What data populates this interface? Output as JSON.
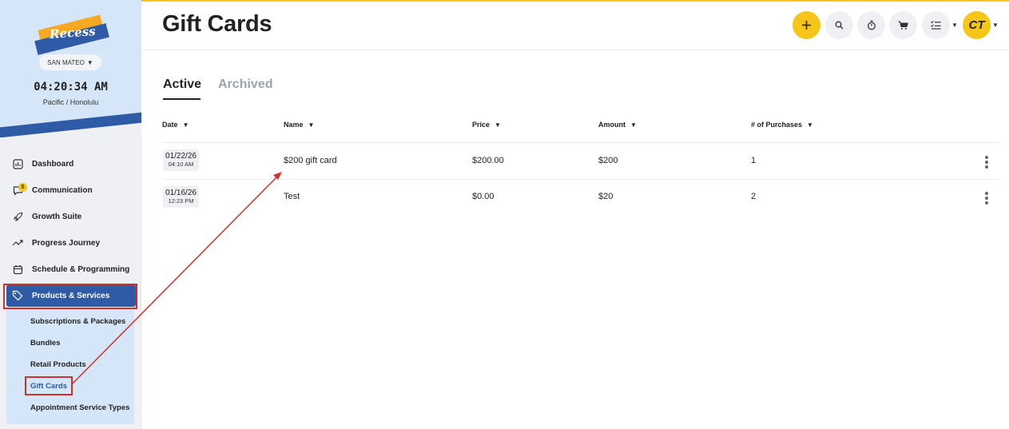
{
  "brand": {
    "logo_text": "Recess",
    "accent": "#f5c518",
    "primary": "#2f5aa6"
  },
  "location": {
    "name": "SAN MATEO"
  },
  "clock": {
    "time": "04:20:34 AM",
    "timezone": "Pacific / Honolulu"
  },
  "sidebar": {
    "items": [
      {
        "label": "Dashboard",
        "icon": "chart-icon"
      },
      {
        "label": "Communication",
        "icon": "chat-icon",
        "badge": "5"
      },
      {
        "label": "Growth Suite",
        "icon": "rocket-icon"
      },
      {
        "label": "Progress Journey",
        "icon": "trend-icon"
      },
      {
        "label": "Schedule & Programming",
        "icon": "calendar-icon"
      },
      {
        "label": "Products & Services",
        "icon": "tag-icon",
        "active": true
      }
    ],
    "subitems": [
      {
        "label": "Subscriptions & Packages"
      },
      {
        "label": "Bundles"
      },
      {
        "label": "Retail Products"
      },
      {
        "label": "Gift Cards",
        "current": true
      },
      {
        "label": "Appointment Service Types"
      }
    ]
  },
  "page": {
    "title": "Gift Cards"
  },
  "toolbar": {
    "avatar_initials": "CT"
  },
  "tabs": [
    {
      "label": "Active",
      "selected": true
    },
    {
      "label": "Archived"
    }
  ],
  "table": {
    "headers": {
      "date": "Date",
      "name": "Name",
      "price": "Price",
      "amount": "Amount",
      "purchases": "# of Purchases"
    },
    "rows": [
      {
        "date": "01/22/26",
        "time": "04:10 AM",
        "name": "$200 gift card",
        "price": "$200.00",
        "amount": "$200",
        "purchases": "1"
      },
      {
        "date": "01/16/26",
        "time": "12:23 PM",
        "name": "Test",
        "price": "$0.00",
        "amount": "$20",
        "purchases": "2"
      }
    ]
  }
}
